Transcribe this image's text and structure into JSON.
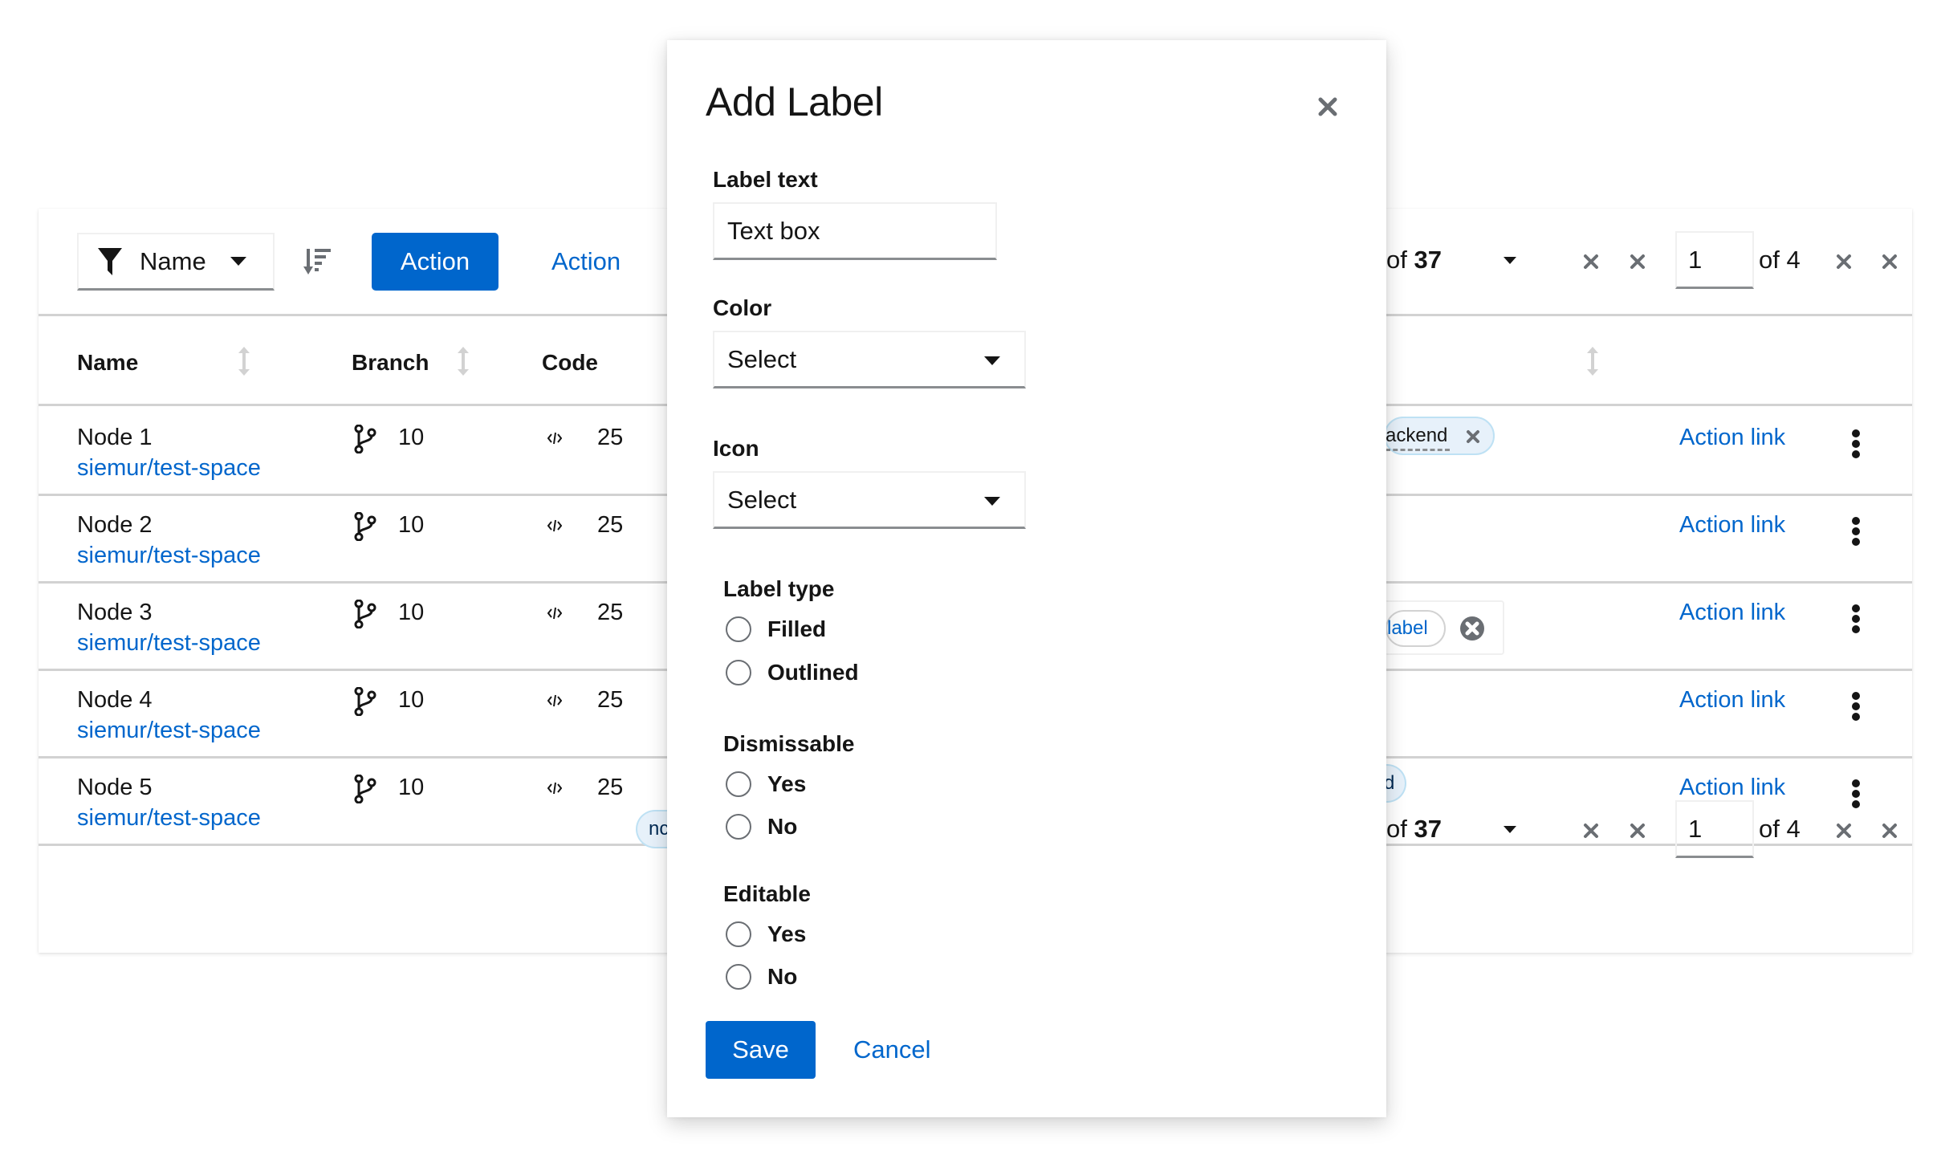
{
  "toolbar": {
    "filter_attribute": "Name",
    "primary_action_label": "Action",
    "link_action_label": "Action"
  },
  "pagination": {
    "items_prefix": "of",
    "items_total": "37",
    "page_value": "1",
    "page_total_label": "of 4"
  },
  "table": {
    "headers": [
      {
        "label": "Name",
        "sortable": true
      },
      {
        "label": "Branch",
        "sortable": true
      },
      {
        "label": "Code",
        "sortable": false
      },
      {
        "label": "",
        "sortable": true
      }
    ],
    "rows": [
      {
        "name": "Node 1",
        "link": "siemur/test-space",
        "branches": "10",
        "code": "25",
        "action": "Action link"
      },
      {
        "name": "Node 2",
        "link": "siemur/test-space",
        "branches": "10",
        "code": "25",
        "action": "Action link"
      },
      {
        "name": "Node 3",
        "link": "siemur/test-space",
        "branches": "10",
        "code": "25",
        "action": "Action link"
      },
      {
        "name": "Node 4",
        "link": "siemur/test-space",
        "branches": "10",
        "code": "25",
        "action": "Action link"
      },
      {
        "name": "Node 5",
        "link": "siemur/test-space",
        "branches": "10",
        "code": "25",
        "action": "Action link"
      }
    ],
    "partial_labels": {
      "row1": "ackend",
      "row3": "label",
      "row5": "d",
      "footer": "nc"
    }
  },
  "modal": {
    "title": "Add Label",
    "label_text": {
      "label": "Label text",
      "value": "Text box"
    },
    "color": {
      "label": "Color",
      "value": "Select"
    },
    "icon": {
      "label": "Icon",
      "value": "Select"
    },
    "label_type": {
      "label": "Label type",
      "options": [
        "Filled",
        "Outlined"
      ]
    },
    "dismissable": {
      "label": "Dismissable",
      "options": [
        "Yes",
        "No"
      ]
    },
    "editable": {
      "label": "Editable",
      "options": [
        "Yes",
        "No"
      ]
    },
    "save_label": "Save",
    "cancel_label": "Cancel"
  },
  "colors": {
    "primary": "#0066cc",
    "text": "#151515",
    "border": "#d2d2d2",
    "icon_gray": "#6a6e73",
    "chip_blue_bg": "#e7f1fa",
    "chip_blue_border": "#bee1f4"
  }
}
